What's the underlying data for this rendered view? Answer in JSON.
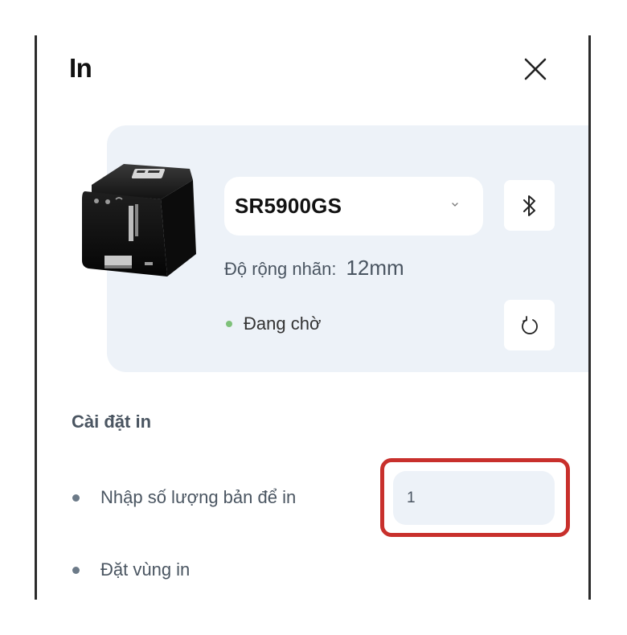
{
  "dialog": {
    "title": "In",
    "close_icon": "close-icon"
  },
  "device": {
    "model": "SR5900GS",
    "dropdown_icon": "chevron-down-icon",
    "bluetooth_icon": "bluetooth-icon",
    "label_width_label": "Độ rộng nhãn:",
    "label_width_value": "12mm",
    "status": "Đang chờ",
    "status_color": "#7ec17a",
    "refresh_icon": "refresh-icon"
  },
  "settings": {
    "section_title": "Cài đặt in",
    "quantity_label": "Nhập số lượng bản để in",
    "quantity_value": "1",
    "print_area_label": "Đặt vùng in"
  },
  "colors": {
    "card_background": "#edf2f8",
    "highlight": "#c8302c",
    "text_secondary": "#4a5561"
  }
}
